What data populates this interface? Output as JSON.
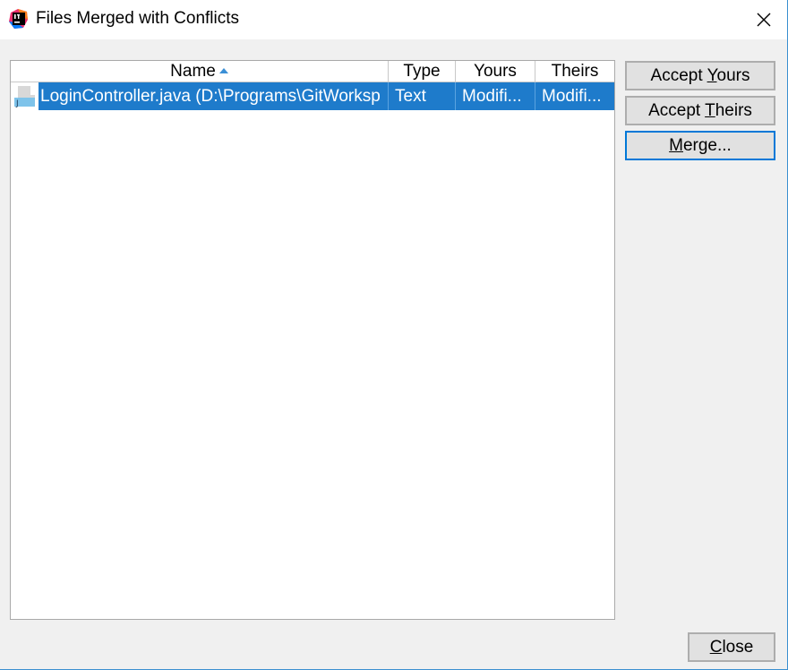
{
  "window": {
    "title": "Files Merged with Conflicts",
    "app_icon": "intellij-idea-icon",
    "close_icon": "close-icon"
  },
  "table": {
    "columns": [
      {
        "label": "Name",
        "sorted": "ascending"
      },
      {
        "label": "Type"
      },
      {
        "label": "Yours"
      },
      {
        "label": "Theirs"
      }
    ],
    "rows": [
      {
        "icon": "java-file-icon",
        "name": "LoginController.java (D:\\Programs\\GitWorksp",
        "type": "Text",
        "yours": "Modifi...",
        "theirs": "Modifi...",
        "selected": true
      }
    ]
  },
  "buttons": {
    "accept_yours": {
      "pre": "Accept ",
      "mnemonic": "Y",
      "post": "ours"
    },
    "accept_theirs": {
      "pre": "Accept ",
      "mnemonic": "T",
      "post": "heirs"
    },
    "merge": {
      "pre": "",
      "mnemonic": "M",
      "post": "erge..."
    },
    "close": {
      "pre": "",
      "mnemonic": "C",
      "post": "lose"
    }
  },
  "colors": {
    "selection": "#1e7bcb",
    "focus_border": "#0078d7",
    "window_bg": "#f0f0f0"
  }
}
